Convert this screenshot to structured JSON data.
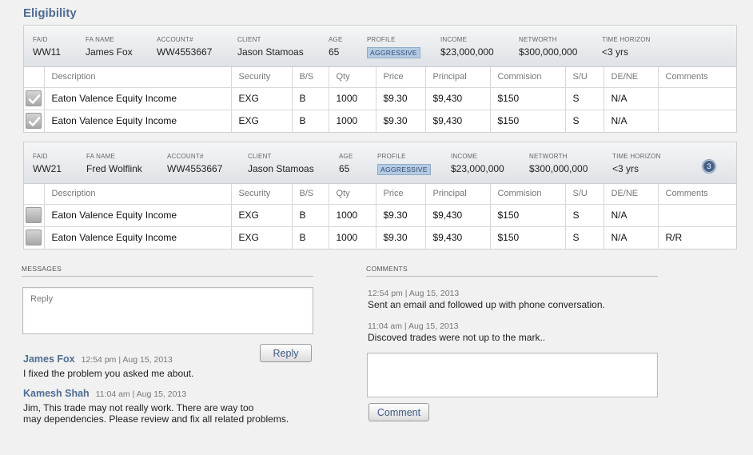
{
  "page": {
    "title": "Eligibility"
  },
  "header_labels": {
    "faid": "FAID",
    "fa_name": "FA NAME",
    "account": "ACCOUNT#",
    "client": "CLIENT",
    "age": "AGE",
    "profile": "PROFILE",
    "income": "INCOME",
    "networth": "NETWORTH",
    "time_horizon": "TIME HORIZON"
  },
  "columns": [
    "Description",
    "Security",
    "B/S",
    "Qty",
    "Price",
    "Principal",
    "Commision",
    "S/U",
    "DE/NE",
    "Comments"
  ],
  "blocks": [
    {
      "faid": "WW11",
      "fa_name": "James Fox",
      "account": "WW4553667",
      "client": "Jason Stamoas",
      "age": "65",
      "profile": "AGGRESSIVE",
      "income": "$23,000,000",
      "networth": "$300,000,000",
      "time_horizon": "<3 yrs",
      "notification_count": "",
      "rows": [
        {
          "checked": true,
          "description": "Eaton Valence Equity Income",
          "security": "EXG",
          "bs": "B",
          "qty": "1000",
          "price": "$9.30",
          "principal": "$9,430",
          "commision": "$150",
          "su": "S",
          "dene": "N/A",
          "comments": ""
        },
        {
          "checked": true,
          "description": "Eaton Valence Equity Income",
          "security": "EXG",
          "bs": "B",
          "qty": "1000",
          "price": "$9.30",
          "principal": "$9,430",
          "commision": "$150",
          "su": "S",
          "dene": "N/A",
          "comments": ""
        }
      ]
    },
    {
      "faid": "WW21",
      "fa_name": "Fred Wolflink",
      "account": "WW4553667",
      "client": "Jason Stamoas",
      "age": "65",
      "profile": "AGGRESSIVE",
      "income": "$23,000,000",
      "networth": "$300,000,000",
      "time_horizon": "<3 yrs",
      "notification_count": "3",
      "rows": [
        {
          "checked": false,
          "description": "Eaton Valence Equity Income",
          "security": "EXG",
          "bs": "B",
          "qty": "1000",
          "price": "$9.30",
          "principal": "$9,430",
          "commision": "$150",
          "su": "S",
          "dene": "N/A",
          "comments": ""
        },
        {
          "checked": false,
          "description": "Eaton Valence Equity Income",
          "security": "EXG",
          "bs": "B",
          "qty": "1000",
          "price": "$9.30",
          "principal": "$9,430",
          "commision": "$150",
          "su": "S",
          "dene": "N/A",
          "comments": "R/R"
        }
      ]
    }
  ],
  "messages": {
    "label": "MESSAGES",
    "reply_placeholder": "Reply",
    "reply_button": "Reply",
    "items": [
      {
        "author": "James Fox",
        "time": "12:54 pm | Aug 15, 2013",
        "lines": [
          "I fixed the problem you asked me about."
        ]
      },
      {
        "author": "Kamesh Shah",
        "time": "11:04 am | Aug 15, 2013",
        "lines": [
          "Jim, This trade may not really work. There are way too",
          "may dependencies. Please review and fix all related problems."
        ]
      }
    ]
  },
  "comments": {
    "label": "COMMENTS",
    "comment_button": "Comment",
    "input_placeholder": "",
    "items": [
      {
        "time": "12:54 pm | Aug 15, 2013",
        "text": "Sent an email and followed up with phone conversation."
      },
      {
        "time": "11:04 am | Aug 15, 2013",
        "text": "Discoved trades were not up to the mark.."
      }
    ]
  },
  "colors": {
    "accent": "#4f6d92",
    "badge_bg": "#b5cbe2",
    "page_bg": "#f1f1f1"
  }
}
